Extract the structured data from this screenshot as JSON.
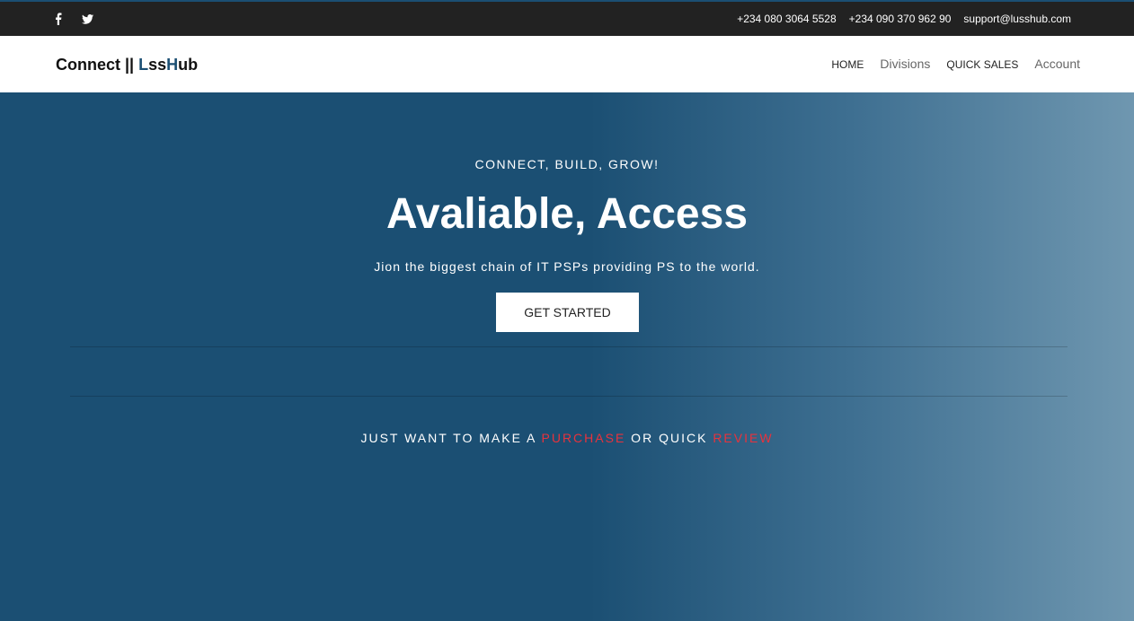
{
  "topbar": {
    "social": [
      {
        "icon": "facebook-icon",
        "label": "f"
      },
      {
        "icon": "twitter-icon",
        "label": "t"
      }
    ],
    "phone1": "+234 080 3064 5528",
    "phone2": "+234 090 370 962 90",
    "email": "support@lusshub.com"
  },
  "navbar": {
    "brand_prefix": "Connect || ",
    "brand_accent_1": "L",
    "brand_mid": "ss",
    "brand_accent_2": "H",
    "brand_suffix": "ub",
    "links": [
      "HOME",
      "Divisions",
      "QUICK SALES",
      "Account"
    ]
  },
  "hero": {
    "tagline": "CONNECT, BUILD, GROW!",
    "headline": "Avaliable, Access",
    "subtext": "Jion the biggest chain of IT PSPs providing PS to the world.",
    "cta_label": "GET STARTED",
    "quick_prefix": "JUST WANT TO MAKE A ",
    "quick_link_1": "PURCHASE",
    "quick_middle": " OR QUICK ",
    "quick_link_2": "REVIEW"
  },
  "colors": {
    "topbar_bg": "#222222",
    "hero_bg": "#1b4f73",
    "accent_red": "#e8323c",
    "brand_blue": "#1b4f73"
  }
}
